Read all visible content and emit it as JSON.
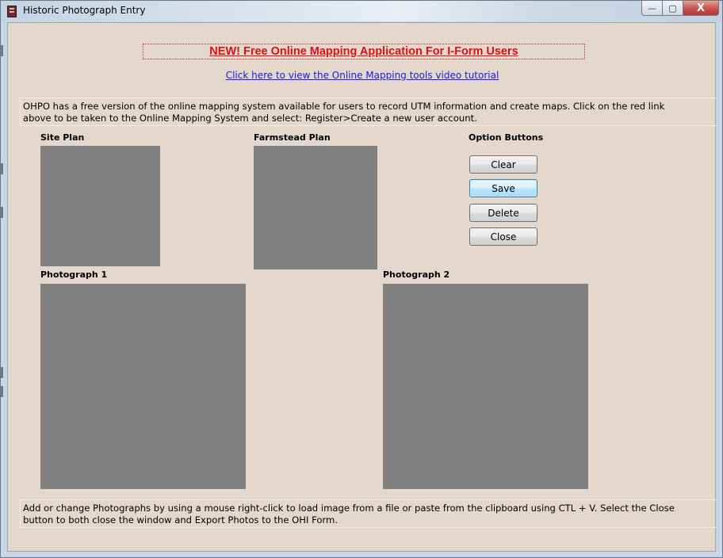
{
  "window": {
    "title": "Historic Photograph Entry",
    "caption_buttons": {
      "minimize": "—",
      "maximize": "▢",
      "close": "X"
    }
  },
  "banner": {
    "headline": "NEW! Free Online Mapping Application For I-Form Users",
    "video_link": "Click here to view the Online Mapping tools video tutorial"
  },
  "info_top": {
    "line1": "OHPO has a free version of the online mapping system available for users to record UTM information and create maps. Click on the red link",
    "line2": "above to be taken to the Online Mapping System and select: Register>Create a new user account."
  },
  "labels": {
    "site_plan": "Site Plan",
    "farmstead_plan": "Farmstead Plan",
    "option_buttons": "Option Buttons",
    "photograph_1": "Photograph 1",
    "photograph_2": "Photograph 2"
  },
  "buttons": {
    "clear": "Clear",
    "save": "Save",
    "delete": "Delete",
    "close": "Close"
  },
  "info_bottom": {
    "line1": "Add or change Photographs by using a mouse right-click to load image from a file or paste from the clipboard using CTL + V.  Select the Close",
    "line2": "button to both close the window and Export Photos to the OHI Form."
  },
  "colors": {
    "form_background": "#e4d8cc",
    "image_placeholder": "#808080",
    "headline_red": "#e01010",
    "link_blue": "#1a1ae0"
  }
}
